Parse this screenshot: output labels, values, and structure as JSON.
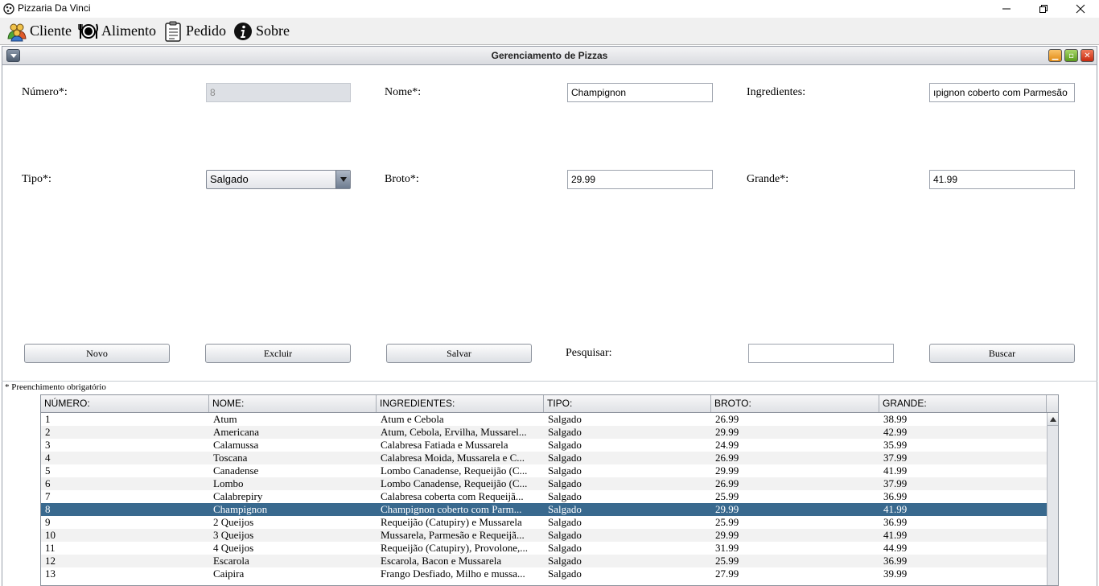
{
  "window": {
    "title": "Pizzaria Da Vinci",
    "controls": [
      "minimize-icon",
      "restore-icon",
      "close-icon"
    ]
  },
  "menu": [
    {
      "label": "Cliente",
      "icon": "people-icon"
    },
    {
      "label": "Alimento",
      "icon": "plate-cutlery-icon"
    },
    {
      "label": "Pedido",
      "icon": "clipboard-icon"
    },
    {
      "label": "Sobre",
      "icon": "info-icon"
    }
  ],
  "frame": {
    "title": "Gerenciamento de Pizzas"
  },
  "form": {
    "numero_label": "Número*:",
    "numero_value": "8",
    "nome_label": "Nome*:",
    "nome_value": "Champignon",
    "ingredientes_label": "Ingredientes:",
    "ingredientes_value": "ıpignon coberto com Parmesão",
    "tipo_label": "Tipo*:",
    "tipo_value": "Salgado",
    "broto_label": "Broto*:",
    "broto_value": "29.99",
    "grande_label": "Grande*:",
    "grande_value": "41.99"
  },
  "buttons": {
    "novo": "Novo",
    "excluir": "Excluir",
    "salvar": "Salvar",
    "pesquisar_label": "Pesquisar:",
    "pesquisar_value": "",
    "buscar": "Buscar"
  },
  "note": "* Preenchimento obrigatório",
  "table": {
    "columns": [
      "NÚMERO:",
      "NOME:",
      "INGREDIENTES:",
      "TIPO:",
      "BROTO:",
      "GRANDE:"
    ],
    "selected_row": 7,
    "rows": [
      [
        "1",
        "Atum",
        "Atum e Cebola",
        "Salgado",
        "26.99",
        "38.99"
      ],
      [
        "2",
        "Americana",
        "Atum, Cebola, Ervilha, Mussarel...",
        "Salgado",
        "29.99",
        "42.99"
      ],
      [
        "3",
        "Calamussa",
        "Calabresa Fatiada e Mussarela",
        "Salgado",
        "24.99",
        "35.99"
      ],
      [
        "4",
        "Toscana",
        "Calabresa Moida, Mussarela e C...",
        "Salgado",
        "26.99",
        "37.99"
      ],
      [
        "5",
        "Canadense",
        "Lombo Canadense, Requeijão (C...",
        "Salgado",
        "29.99",
        "41.99"
      ],
      [
        "6",
        "Lombo",
        "Lombo Canadense, Requeijão (C...",
        "Salgado",
        "26.99",
        "37.99"
      ],
      [
        "7",
        "Calabrepiry",
        "Calabresa coberta com Requeijã...",
        "Salgado",
        "25.99",
        "36.99"
      ],
      [
        "8",
        "Champignon",
        "Champignon coberto com Parm...",
        "Salgado",
        "29.99",
        "41.99"
      ],
      [
        "9",
        "2 Queijos",
        "Requeijão (Catupiry) e Mussarela",
        "Salgado",
        "25.99",
        "36.99"
      ],
      [
        "10",
        "3 Queijos",
        "Mussarela, Parmesão e Requeijã...",
        "Salgado",
        "29.99",
        "41.99"
      ],
      [
        "11",
        "4 Queijos",
        "Requeijão (Catupiry), Provolone,...",
        "Salgado",
        "31.99",
        "44.99"
      ],
      [
        "12",
        "Escarola",
        "Escarola, Bacon e Mussarela",
        "Salgado",
        "25.99",
        "36.99"
      ],
      [
        "13",
        "Caipira",
        "Frango Desfiado, Milho e mussa...",
        "Salgado",
        "27.99",
        "39.99"
      ]
    ]
  }
}
